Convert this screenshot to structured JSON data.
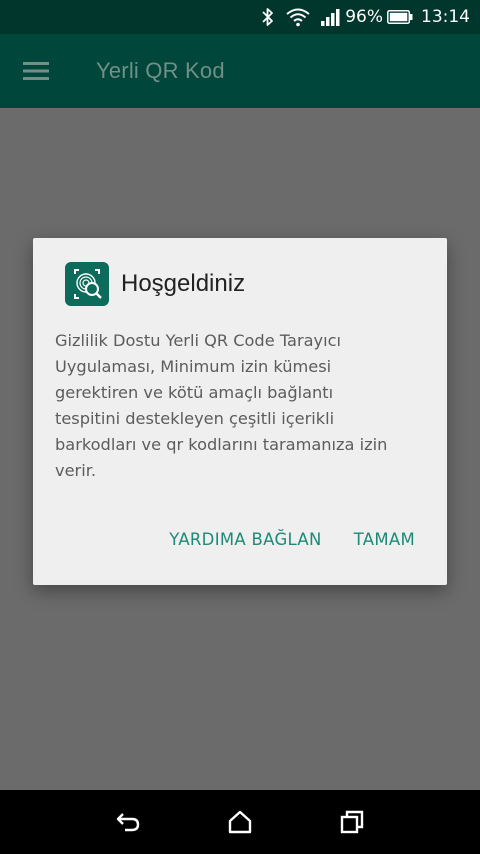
{
  "status_bar": {
    "battery_percent": "96%",
    "time": "13:14",
    "icons": [
      "bluetooth-icon",
      "wifi-icon",
      "signal-icon",
      "battery-icon"
    ]
  },
  "app_bar": {
    "title": "Yerli QR Kod",
    "menu_icon": "hamburger-menu-icon"
  },
  "dialog": {
    "title": "Hoşgeldiniz",
    "icon": "fingerprint-search-icon",
    "body_lines": [
      "Gizlilik Dostu Yerli QR Code Tarayıcı",
      "Uygulaması, Minimum izin kümesi",
      "gerektiren ve kötü amaçlı bağlantı",
      "tespitini destekleyen çeşitli içerikli",
      "barkodları ve qr kodlarını taramanıza izin",
      "verir."
    ],
    "buttons": {
      "help": "YARDIMA BAĞLAN",
      "ok": "TAMAM"
    }
  },
  "nav_bar": {
    "icons": [
      "back-icon",
      "home-icon",
      "recents-icon"
    ]
  },
  "colors": {
    "status_bar": "#00362c",
    "app_bar": "#00463a",
    "accent": "#1d8a78",
    "scrim": "#6b6b6b",
    "dialog_bg": "#efefef"
  }
}
